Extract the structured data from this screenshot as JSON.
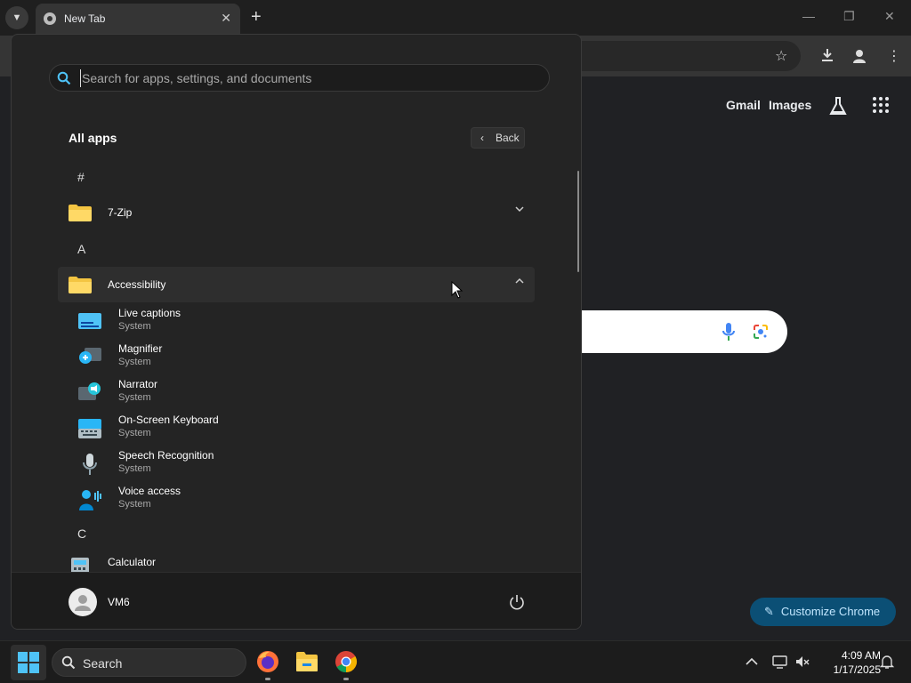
{
  "browser": {
    "tab_title": "New Tab",
    "google_links": {
      "gmail": "Gmail",
      "images": "Images"
    },
    "customize_label": "Customize Chrome"
  },
  "start_menu": {
    "search_placeholder": "Search for apps, settings, and documents",
    "all_apps_title": "All apps",
    "back_label": "Back",
    "sections": [
      {
        "letter": "#"
      },
      {
        "letter": "A"
      },
      {
        "letter": "C"
      }
    ],
    "folders": [
      {
        "label": "7-Zip",
        "expanded": false
      },
      {
        "label": "Accessibility",
        "expanded": true
      }
    ],
    "accessibility_apps": [
      {
        "name": "Live captions",
        "sub": "System",
        "icon": "live-captions-icon"
      },
      {
        "name": "Magnifier",
        "sub": "System",
        "icon": "magnifier-icon"
      },
      {
        "name": "Narrator",
        "sub": "System",
        "icon": "narrator-icon"
      },
      {
        "name": "On-Screen Keyboard",
        "sub": "System",
        "icon": "keyboard-icon"
      },
      {
        "name": "Speech Recognition",
        "sub": "System",
        "icon": "microphone-icon"
      },
      {
        "name": "Voice access",
        "sub": "System",
        "icon": "voice-access-icon"
      }
    ],
    "c_apps": [
      {
        "name": "Calculator",
        "icon": "calculator-icon"
      }
    ],
    "user_name": "VM6"
  },
  "taskbar": {
    "search_label": "Search",
    "pinned_apps": [
      "firefox-icon",
      "file-explorer-icon",
      "chrome-icon"
    ],
    "clock": {
      "time": "4:09 AM",
      "date": "1/17/2025"
    }
  },
  "colors": {
    "accent": "#0b4f75",
    "folder": "#f4c542",
    "menu_bg": "#242424"
  }
}
